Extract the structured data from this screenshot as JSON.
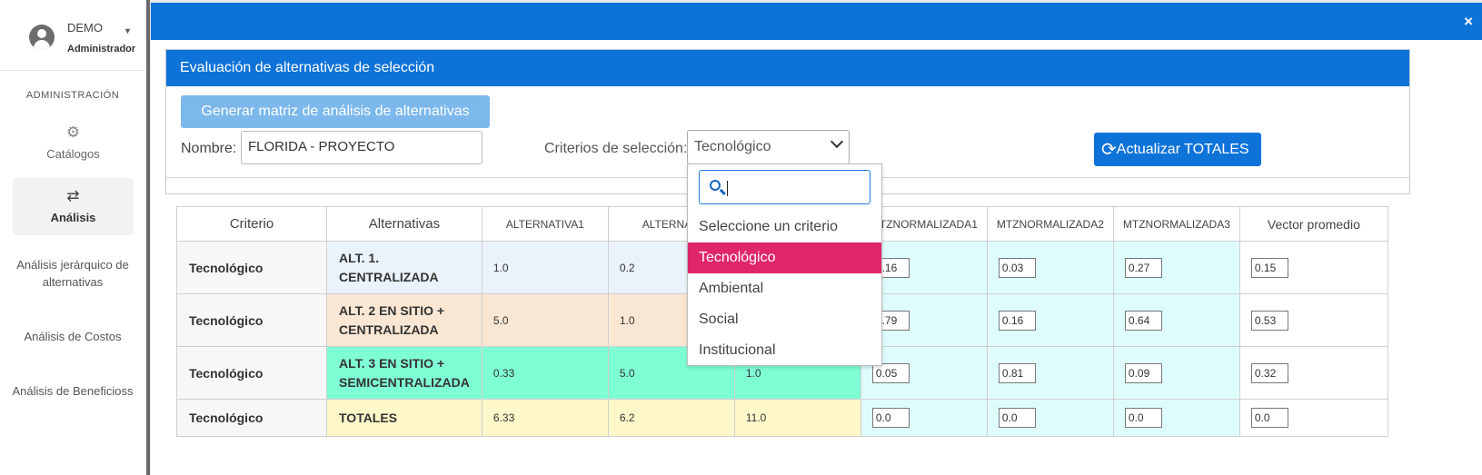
{
  "sidebar": {
    "user_name": "DEMO",
    "user_role": "Administrador",
    "section_title": "ADMINISTRACIÓN",
    "items": [
      {
        "label": "Catálogos"
      },
      {
        "label": "Análisis"
      }
    ],
    "subitems": [
      {
        "label": "Análisis jerárquico de alternativas"
      },
      {
        "label": "Análisis de Costos"
      },
      {
        "label": "Análisis de Beneficioss"
      }
    ]
  },
  "modal": {
    "close_symbol": "×"
  },
  "panel": {
    "title": "Evaluación de alternativas de selección",
    "generate_button": "Generar matriz de análisis de alternativas",
    "name_label": "Nombre:",
    "name_value": "FLORIDA - PROYECTO",
    "criteria_label": "Criterios de selección:",
    "criteria_value": "Tecnológico",
    "update_button": "Actualizar TOTALES"
  },
  "table": {
    "headers": [
      "Criterio",
      "Alternativas",
      "ALTERNATIVA1",
      "ALTERNATI",
      "",
      "MTZNORMALIZADA1",
      "MTZNORMALIZADA2",
      "MTZNORMALIZADA3",
      "Vector promedio"
    ],
    "rows": [
      {
        "criterio": "Tecnológico",
        "alt_line1": "ALT. 1.",
        "alt_line2": "CENTRALIZADA",
        "a1": "1.0",
        "a2": "0.2",
        "a3": "",
        "n1": "0.16",
        "n2": "0.03",
        "n3": "0.27",
        "vec": "0.15"
      },
      {
        "criterio": "Tecnológico",
        "alt_line1": "ALT. 2 EN SITIO +",
        "alt_line2": "CENTRALIZADA",
        "a1": "5.0",
        "a2": "1.0",
        "a3": "",
        "n1": "0.79",
        "n2": "0.16",
        "n3": "0.64",
        "vec": "0.53"
      },
      {
        "criterio": "Tecnológico",
        "alt_line1": "ALT. 3 EN SITIO +",
        "alt_line2": "SEMICENTRALIZADA",
        "a1": "0.33",
        "a2": "5.0",
        "a3": "1.0",
        "n1": "0.05",
        "n2": "0.81",
        "n3": "0.09",
        "vec": "0.32"
      },
      {
        "criterio": "Tecnológico",
        "alt_line1": "TOTALES",
        "alt_line2": "",
        "a1": "6.33",
        "a2": "6.2",
        "a3": "11.0",
        "n1": "0.0",
        "n2": "0.0",
        "n3": "0.0",
        "vec": "0.0"
      }
    ]
  },
  "dropdown": {
    "search_value": "",
    "options": [
      "Seleccione un criterio",
      "Tecnológico",
      "Ambiental",
      "Social",
      "Institucional"
    ],
    "selected": "Tecnológico"
  }
}
